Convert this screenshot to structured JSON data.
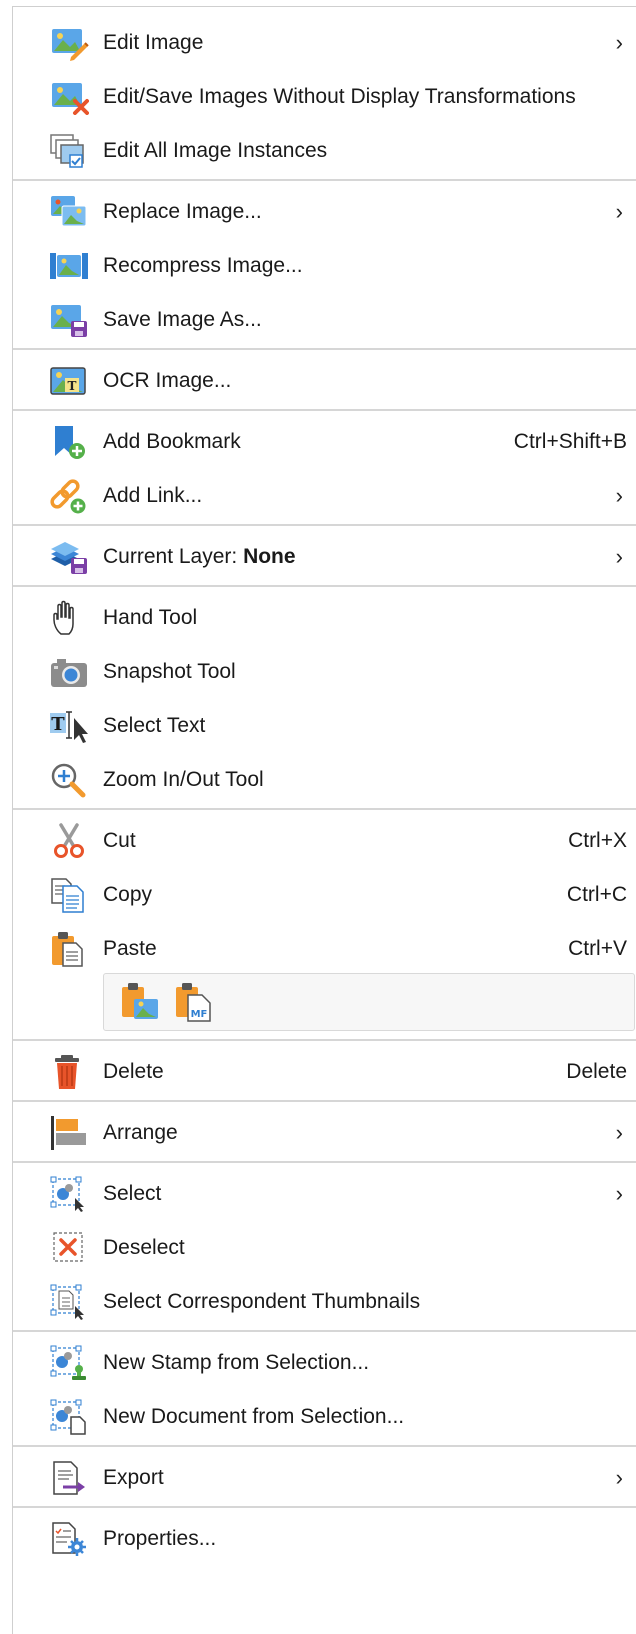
{
  "menu": {
    "edit_image": "Edit Image",
    "edit_save_no_transform": "Edit/Save Images Without Display Transformations",
    "edit_all_instances": "Edit All Image Instances",
    "replace_image": "Replace Image...",
    "recompress_image": "Recompress Image...",
    "save_image_as": "Save Image As...",
    "ocr_image": "OCR Image...",
    "add_bookmark": "Add Bookmark",
    "add_bookmark_shortcut": "Ctrl+Shift+B",
    "add_link": "Add Link...",
    "current_layer_prefix": "Current Layer: ",
    "current_layer_value": "None",
    "hand_tool": "Hand Tool",
    "snapshot_tool": "Snapshot Tool",
    "select_text": "Select Text",
    "zoom_tool": "Zoom In/Out Tool",
    "cut": "Cut",
    "cut_shortcut": "Ctrl+X",
    "copy": "Copy",
    "copy_shortcut": "Ctrl+C",
    "paste": "Paste",
    "paste_shortcut": "Ctrl+V",
    "delete": "Delete",
    "delete_shortcut": "Delete",
    "arrange": "Arrange",
    "select": "Select",
    "deselect": "Deselect",
    "select_thumbnails": "Select Correspondent Thumbnails",
    "new_stamp": "New Stamp from Selection...",
    "new_document": "New Document from Selection...",
    "export": "Export",
    "properties": "Properties...",
    "submenu_arrow": "›"
  },
  "icons": {
    "edit_image": "image-edit-icon",
    "edit_save": "image-x-icon",
    "edit_all": "image-stack-icon",
    "replace": "image-replace-icon",
    "recompress": "image-compress-icon",
    "save_as": "image-save-icon",
    "ocr": "ocr-image-icon",
    "bookmark": "bookmark-add-icon",
    "link": "link-add-icon",
    "layer": "layers-icon",
    "hand": "hand-icon",
    "snapshot": "camera-icon",
    "select_text": "text-cursor-icon",
    "zoom": "zoom-icon",
    "cut": "scissors-icon",
    "copy": "copy-icon",
    "paste": "paste-icon",
    "delete": "trash-icon",
    "arrange": "arrange-icon",
    "select": "select-object-icon",
    "deselect": "deselect-icon",
    "thumbnails": "select-thumbnails-icon",
    "stamp": "stamp-icon",
    "document": "new-document-icon",
    "export": "export-icon",
    "properties": "properties-icon"
  },
  "colors": {
    "separator": "#d6d6d6",
    "accent_blue": "#2f7fd1",
    "accent_orange": "#f29a2e",
    "accent_red": "#e8542a",
    "accent_green": "#55b04a"
  }
}
